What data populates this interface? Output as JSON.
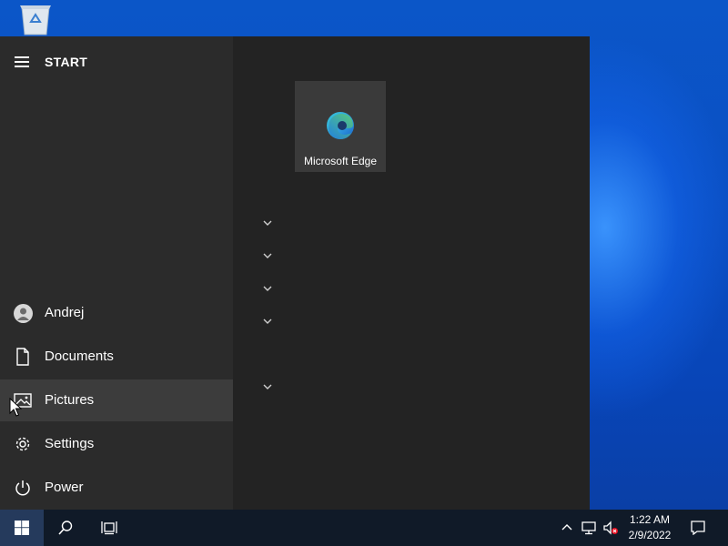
{
  "start_menu": {
    "title": "START",
    "left_items": [
      {
        "label": "Andrej",
        "icon": "user-avatar-icon"
      },
      {
        "label": "Documents",
        "icon": "document-icon"
      },
      {
        "label": "Pictures",
        "icon": "pictures-icon",
        "active": true
      },
      {
        "label": "Settings",
        "icon": "gear-icon"
      },
      {
        "label": "Power",
        "icon": "power-icon"
      }
    ],
    "tiles": [
      {
        "label": "Microsoft Edge",
        "icon": "edge-icon"
      }
    ],
    "group_chevrons": 5
  },
  "taskbar": {
    "icons": [
      "windows-start-icon",
      "search-icon",
      "task-view-icon"
    ],
    "tray_icons": [
      "chevron-up-icon",
      "network-icon",
      "volume-muted-icon",
      "notifications-icon"
    ],
    "time": "1:22 AM",
    "date": "2/9/2022"
  },
  "colors": {
    "start_left": "#2b2b2b",
    "start_right": "#232323",
    "active_item": "#3c3c3c",
    "taskbar": "#101a28",
    "accent": "#0a4fc3"
  }
}
